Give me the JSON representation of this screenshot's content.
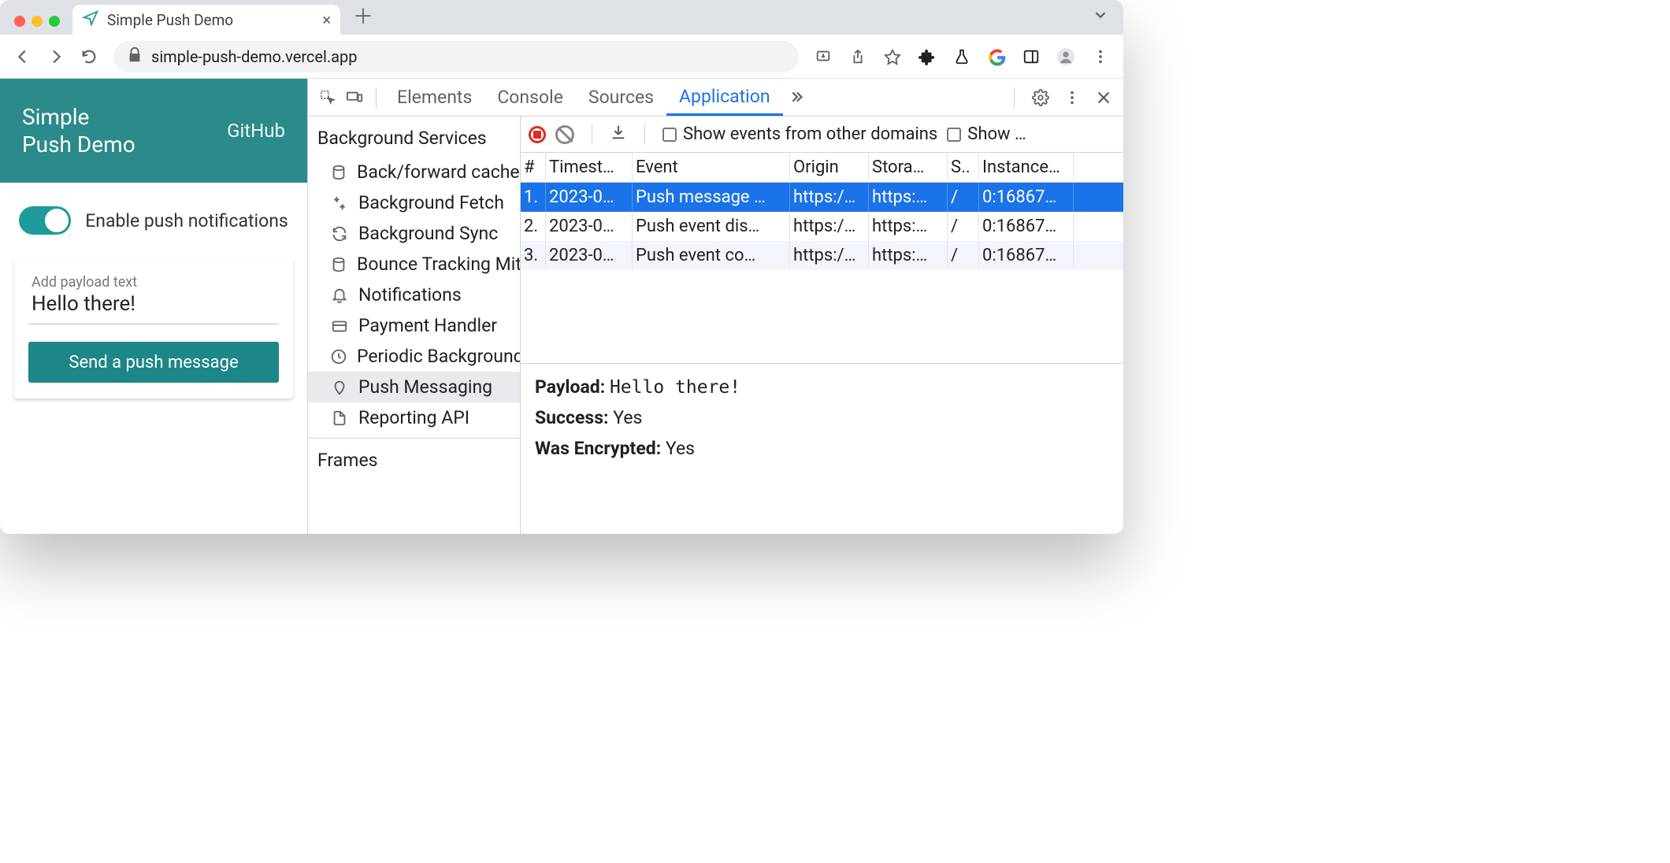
{
  "browser": {
    "tab_title": "Simple Push Demo",
    "url": "simple-push-demo.vercel.app"
  },
  "page": {
    "title_line1": "Simple",
    "title_line2": "Push Demo",
    "github": "GitHub",
    "toggle_label": "Enable push notifications",
    "payload_placeholder": "Add payload text",
    "payload_value": "Hello there!",
    "send_button": "Send a push message"
  },
  "devtools": {
    "tabs": {
      "elements": "Elements",
      "console": "Console",
      "sources": "Sources",
      "application": "Application"
    },
    "toolbar": {
      "show_other": "Show events from other domains",
      "show_trunc": "Show …"
    },
    "sidebar": {
      "heading": "Background Services",
      "items": [
        "Back/forward cache",
        "Background Fetch",
        "Background Sync",
        "Bounce Tracking Mitigations",
        "Notifications",
        "Payment Handler",
        "Periodic Background Sync",
        "Push Messaging",
        "Reporting API"
      ],
      "frames": "Frames"
    },
    "grid": {
      "headers": [
        "#",
        "Timest…",
        "Event",
        "Origin",
        "Stora…",
        "S..",
        "Instance…"
      ],
      "rows": [
        {
          "n": "1.",
          "ts": "2023-0…",
          "event": "Push message …",
          "origin": "https:/…",
          "storage": "https:…",
          "s": "/",
          "instance": "0:16867…"
        },
        {
          "n": "2.",
          "ts": "2023-0…",
          "event": "Push event dis…",
          "origin": "https:/…",
          "storage": "https:…",
          "s": "/",
          "instance": "0:16867…"
        },
        {
          "n": "3.",
          "ts": "2023-0…",
          "event": "Push event co…",
          "origin": "https:/…",
          "storage": "https:…",
          "s": "/",
          "instance": "0:16867…"
        }
      ]
    },
    "detail": {
      "payload_label": "Payload:",
      "payload_value": "Hello there!",
      "success_label": "Success:",
      "success_value": "Yes",
      "enc_label": "Was Encrypted:",
      "enc_value": "Yes"
    }
  }
}
